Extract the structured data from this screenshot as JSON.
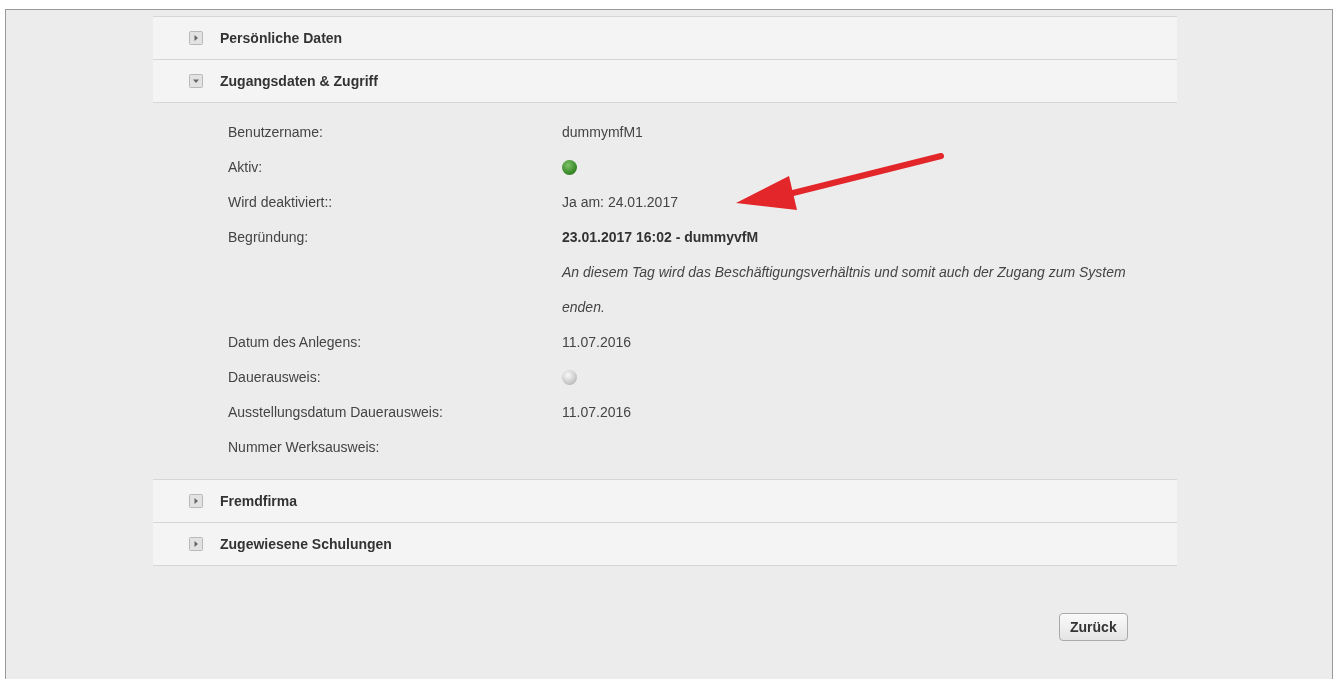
{
  "sections": [
    {
      "title": "Persönliche Daten",
      "expanded": false
    },
    {
      "title": "Zugangsdaten & Zugriff",
      "expanded": true,
      "fields": [
        {
          "label": "Benutzername:",
          "values": [
            {
              "kind": "text",
              "text": "dummymfM1"
            }
          ]
        },
        {
          "label": "Aktiv:",
          "values": [
            {
              "kind": "status",
              "on": true
            }
          ]
        },
        {
          "label": "Wird deaktiviert::",
          "values": [
            {
              "kind": "text",
              "text": "Ja am: 24.01.2017"
            }
          ]
        },
        {
          "label": "Begründung:",
          "values": [
            {
              "kind": "bold",
              "text": "23.01.2017 16:02 - dummyvfM"
            },
            {
              "kind": "italic",
              "text": "An diesem Tag wird das Beschäftigungsverhältnis und somit auch der Zugang zum System enden."
            }
          ]
        },
        {
          "label": "Datum des Anlegens:",
          "values": [
            {
              "kind": "text",
              "text": "11.07.2016"
            }
          ]
        },
        {
          "label": "Dauerausweis:",
          "values": [
            {
              "kind": "status",
              "on": false
            }
          ]
        },
        {
          "label": "Ausstellungsdatum Dauerausweis:",
          "values": [
            {
              "kind": "text",
              "text": "11.07.2016"
            }
          ]
        },
        {
          "label": "Nummer Werksausweis:"
        }
      ]
    },
    {
      "title": "Fremdfirma",
      "expanded": false
    },
    {
      "title": "Zugewiesene Schulungen",
      "expanded": false
    }
  ],
  "buttons": [
    "Zurück"
  ]
}
